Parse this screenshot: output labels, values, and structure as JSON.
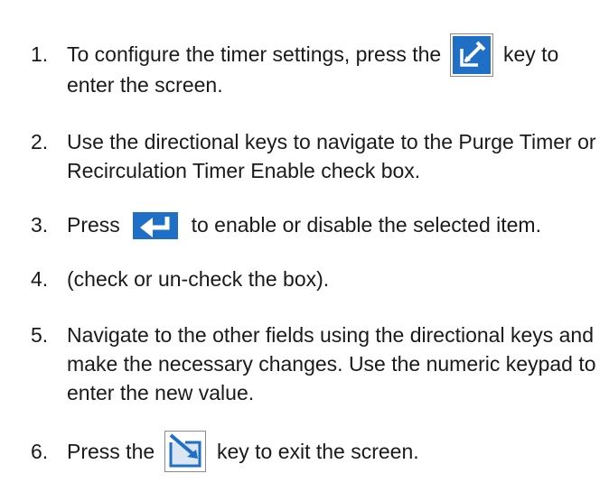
{
  "steps": [
    {
      "number": "1.",
      "before_icon": "To configure the timer settings, press the",
      "icon": "edit-icon",
      "after_icon": "key to enter the screen."
    },
    {
      "number": "2.",
      "text": "Use the directional keys to navigate to the Purge Timer or Recirculation Timer Enable check box."
    },
    {
      "number": "3.",
      "before_icon": "Press",
      "icon": "enter-key-icon",
      "after_icon": "to enable or disable the selected item."
    },
    {
      "number": "4.",
      "text": "(check or un-check the box)."
    },
    {
      "number": "5.",
      "text": "Navigate to the other fields using the directional keys and make the necessary changes. Use the numeric keypad to enter the new value."
    },
    {
      "number": "6.",
      "before_icon": "Press the",
      "icon": "exit-screen-icon",
      "after_icon": "key to exit the screen."
    }
  ],
  "colors": {
    "icon_blue": "#1f6fc7",
    "text": "#1a1a1a"
  }
}
